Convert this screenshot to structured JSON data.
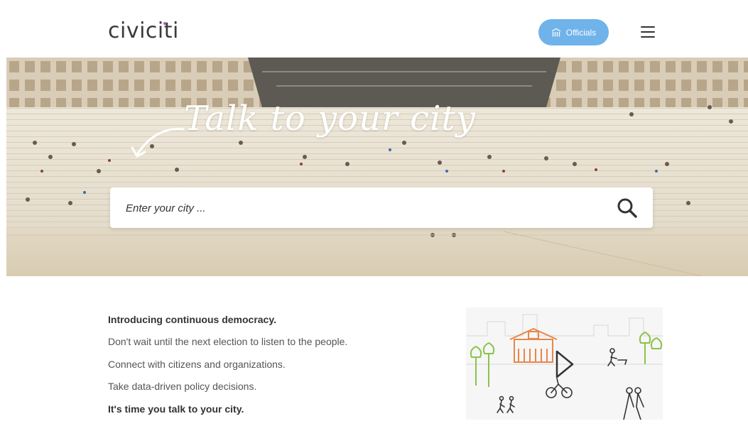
{
  "header": {
    "logo_text": "civiciti",
    "officials_label": "Officials",
    "officials_icon": "building-icon",
    "menu_icon": "hamburger-icon"
  },
  "hero": {
    "title": "Talk to your city",
    "arrow_icon": "curved-arrow-icon",
    "search_placeholder": "Enter your city ...",
    "search_icon": "search-icon"
  },
  "intro": {
    "heading": "Introducing continuous democracy.",
    "lines": [
      "Don't wait until the next election to listen to the people.",
      "Connect with citizens and organizations.",
      "Take data-driven policy decisions."
    ],
    "closing": "It's time you talk to your city."
  },
  "video": {
    "play_icon": "play-icon"
  },
  "colors": {
    "accent": "#6fb3ea",
    "logo_dot": "#b25ab8",
    "illustration_orange": "#e8874a",
    "illustration_green": "#8bc34a"
  }
}
